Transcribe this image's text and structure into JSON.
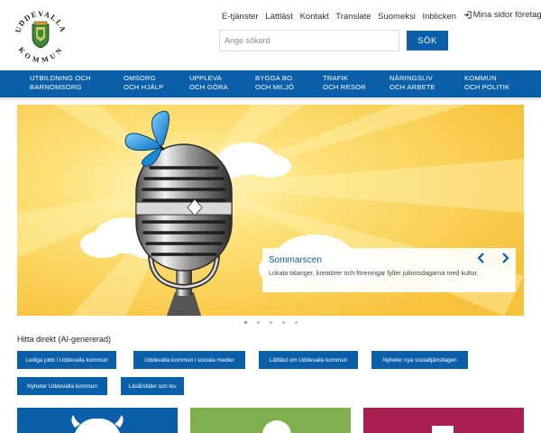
{
  "brand": {
    "logo_text": "UDDEVALLA KOMMUN",
    "primary_color": "#0a5fa8"
  },
  "top_links": [
    {
      "label": "E-tjänster"
    },
    {
      "label": "Lättläst"
    },
    {
      "label": "Kontakt"
    },
    {
      "label": "Translate"
    },
    {
      "label": "Suomeksi"
    },
    {
      "label": "Inblicken"
    }
  ],
  "login_link": {
    "label": "Mina sidor företagare",
    "icon": "login-icon"
  },
  "search": {
    "placeholder": "Ange sökord",
    "button_label": "SÖK"
  },
  "nav": [
    {
      "line1": "UTBILDNING OCH",
      "line2": "BARNOMSORG"
    },
    {
      "line1": "OMSORG",
      "line2": "OCH HJÄLP"
    },
    {
      "line1": "UPPLEVA",
      "line2": "OCH GÖRA"
    },
    {
      "line1": "BYGGA BO",
      "line2": "OCH MILJÖ"
    },
    {
      "line1": "TRAFIK",
      "line2": "OCH RESOR"
    },
    {
      "line1": "NÄRINGSLIV",
      "line2": "OCH ARBETE"
    },
    {
      "line1": "KOMMUN",
      "line2": "OCH POLITIK"
    }
  ],
  "hero": {
    "title": "Sommarscen",
    "text": "Lokala talanger, kreatörer och föreningar fyller julionsdagarna med kultur.",
    "slide_count": 5,
    "active_slide": 1
  },
  "hitta_direkt": {
    "title": "Hitta direkt (AI-genererad)",
    "links": [
      {
        "label": "Lediga jobb i Uddevalla kommun"
      },
      {
        "label": "Uddevalla kommun i sociala medier"
      },
      {
        "label": "Lättläst om Uddevalla kommun"
      },
      {
        "label": "Nyheter nya socialtjänstlagen"
      },
      {
        "label": "Nyheter Uddevalla kommun"
      },
      {
        "label": "Läsårstider och lov"
      }
    ]
  },
  "tiles": [
    {
      "color": "#0a5fa8"
    },
    {
      "color": "#7fb04d"
    },
    {
      "color": "#a81f4f"
    }
  ]
}
